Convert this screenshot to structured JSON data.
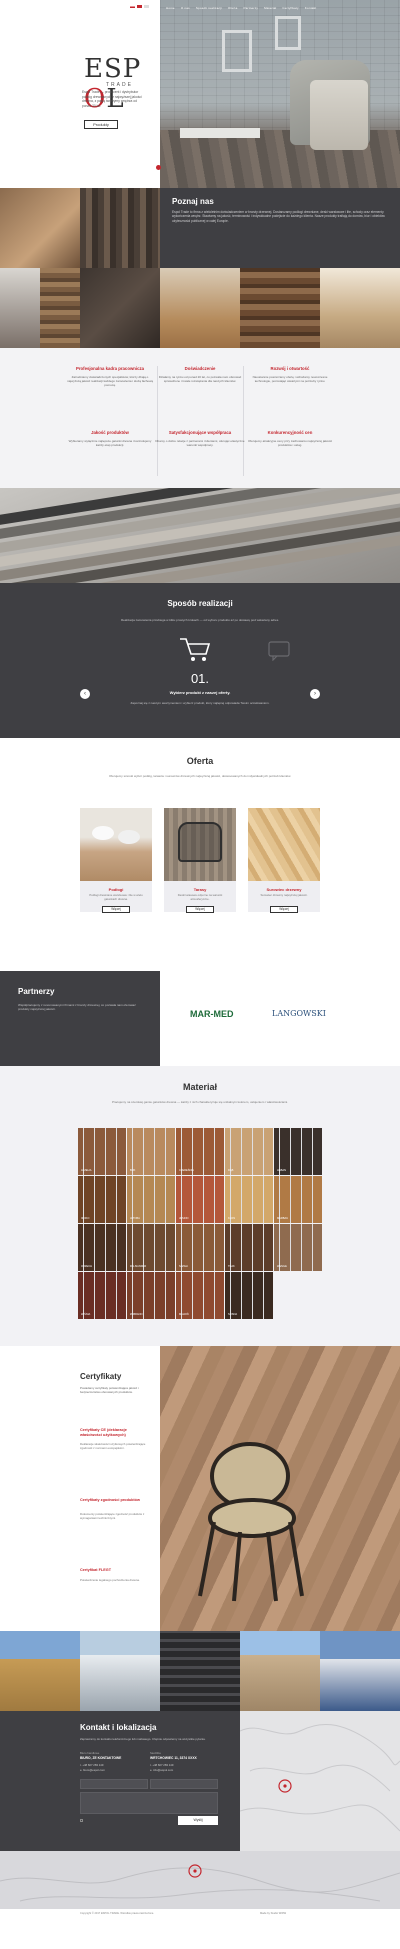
{
  "nav": {
    "items": [
      "Home",
      "O nas",
      "Sposób realizacji",
      "Oferta",
      "Partnerzy",
      "Materiał",
      "Certyfikaty",
      "Kontakt"
    ]
  },
  "hero": {
    "logo_text": "ESP",
    "logo_o": "O",
    "logo_l": "L",
    "logo_sub": "TRADE",
    "text": "Espol Trade — producent i dystrybutor podłóg drewnianych z najwyższej jakości drewna, z pasją tworzymy wnętrza od ponad 20 lat.",
    "button": "Produkty"
  },
  "poznaj": {
    "title": "Poznaj nas",
    "text": "Espol Trade to firma z wieloletnim doświadczeniem w branży drzewnej. Dostarczamy podłogi drewniane, deski warstwowe i lite, schody oraz elementy wykończenia wnętrz. Stawiamy na jakość, terminowość i indywidualne podejście do każdego klienta. Nasze produkty trafiają do domów, biur i obiektów użyteczności publicznej w całej Europie."
  },
  "features": [
    {
      "title": "Profesjonalna kadra pracownicza",
      "text": "Zatrudniamy doświadczonych specjalistów, którzy dbają o najwyższą jakość realizacji każdego zamówienia i służą fachową pomocą."
    },
    {
      "title": "Doświadczenie",
      "text": "Działamy na rynku od ponad 20 lat, co pozwala nam oferować sprawdzone i trwałe rozwiązania dla naszych klientów."
    },
    {
      "title": "Rozwój i otwartość",
      "text": "Nieustannie poszerzamy ofertę i wdrażamy nowoczesne technologie, pozostając otwartymi na potrzeby rynku."
    },
    {
      "title": "Jakość produktów",
      "text": "Wybieramy wyłącznie najlepsze gatunki drewna i kontrolujemy każdy etap produkcji."
    },
    {
      "title": "Satysfakcjonujące współpraca",
      "text": "Dbamy o dobre relacje z partnerami i klientami, oferując elastyczne warunki współpracy."
    },
    {
      "title": "Konkurencyjność cen",
      "text": "Oferujemy atrakcyjne ceny przy zachowaniu najwyższej jakości produktów i usług."
    }
  ],
  "sposob": {
    "title": "Sposób realizacji",
    "intro": "Realizacja zamówienia przebiega w kilku prostych krokach — od wyboru produktu aż po dostawę pod wskazany adres.",
    "step_number": "01.",
    "step_title": "Wybierz produkt z naszej oferty.",
    "step_text": "Zapoznaj się z naszym asortymentem i wybierz produkt, który najlepiej odpowiada Twoim oczekiwaniom."
  },
  "oferta": {
    "title": "Oferta",
    "intro": "Oferujemy szeroki wybór podłóg, tarasów i surowców drzewnych najwyższej jakości, dostosowanych do indywidualnych potrzeb klientów.",
    "cards": [
      {
        "title": "Podłogi",
        "text": "Podłogi drewniane warstwowe i lite w wielu gatunkach drewna.",
        "button": "Więcej"
      },
      {
        "title": "Tarasy",
        "text": "Deski tarasowe odporne na warunki atmosferyczne.",
        "button": "Więcej"
      },
      {
        "title": "Surowiec drzewny",
        "text": "Surowiec drzewny najwyższej jakości.",
        "button": "Więcej"
      }
    ]
  },
  "partnerzy": {
    "title": "Partnerzy",
    "text": "Współpracujemy z renomowanymi firmami z branży drzewnej, co pozwala nam oferować produkty najwyższej jakości.",
    "logos": [
      "MAR-MED",
      "LANGOWSKI"
    ]
  },
  "material": {
    "title": "Materiał",
    "intro": "Pracujemy na szerokiej gamie gatunków drewna — każdy z nich charakteryzuje się unikalnym kolorem, usłojeniem i właściwościami.",
    "swatches": [
      {
        "name": "AFZELIA",
        "color": "#8b5a3c"
      },
      {
        "name": "BUK",
        "color": "#b98a5e"
      },
      {
        "name": "CZEREŚNIA",
        "color": "#9c5a36"
      },
      {
        "name": "DĄB",
        "color": "#c9a274"
      },
      {
        "name": "HEBAN",
        "color": "#3a302b"
      },
      {
        "name": "IROKO",
        "color": "#6f4426"
      },
      {
        "name": "JATOBA",
        "color": "#b58853"
      },
      {
        "name": "JESION",
        "color": "#b4573a"
      },
      {
        "name": "KLON",
        "color": "#d3a86a"
      },
      {
        "name": "MERBAU",
        "color": "#b07a45"
      },
      {
        "name": "ORZECH",
        "color": "#4a3122"
      },
      {
        "name": "PALISANDER",
        "color": "#6d4a30"
      },
      {
        "name": "SAPELI",
        "color": "#8a5a38"
      },
      {
        "name": "TEAK",
        "color": "#5c3d2a"
      },
      {
        "name": "WENGE",
        "color": "#8f6b4f"
      },
      {
        "name": "WIŚNIA",
        "color": "#6a2e24"
      },
      {
        "name": "ZEBRANO",
        "color": "#7b3f2a"
      },
      {
        "name": "MAHOŃ",
        "color": "#8f4a30"
      },
      {
        "name": "SOSNA",
        "color": "#3b2a20"
      }
    ]
  },
  "certyfikaty": {
    "title": "Certyfikaty",
    "intro": "Posiadamy certyfikaty potwierdzające jakość i bezpieczeństwo oferowanych produktów.",
    "items": [
      {
        "title": "Certyfikaty CE (deklaracje właściwości użytkowych)",
        "text": "Deklaracje właściwości użytkowych potwierdzające zgodność z normami europejskimi."
      },
      {
        "title": "Certyfikaty zgodności produktów",
        "text": "Dokumenty potwierdzające zgodność produktów z wymaganiami technicznymi."
      },
      {
        "title": "Certyfikat FLEGT",
        "text": "Potwierdzenie legalnego pochodzenia drewna."
      }
    ]
  },
  "kontakt": {
    "title": "Kontakt i lokalizacja",
    "intro": "Zapraszamy do kontaktu telefonicznego lub mailowego. Chętnie odpowiemy na wszystkie pytania.",
    "office1_label": "Biuro handlowe",
    "office1_name": "BIURO, ZE KONTAKTOWE",
    "office1_phone": "t. +48 607 283 149",
    "office1_mail": "e. biuro@espol.com",
    "office2_label": "Siedziba",
    "office2_name": "WRTCHOWIEC 11, 3374 XXXX",
    "office2_phone": "t. +48 607 283 149",
    "office2_mail": "e. info@espol.com",
    "send_button": "Wyślij"
  },
  "footer": {
    "left": "Copyright © 2017 ESPOL TRADE. Wszelkie prawa zastrzeżone.",
    "right": "Made by Studio WWW"
  },
  "colors": {
    "accent": "#c4262e",
    "dark": "#3f3f43"
  }
}
